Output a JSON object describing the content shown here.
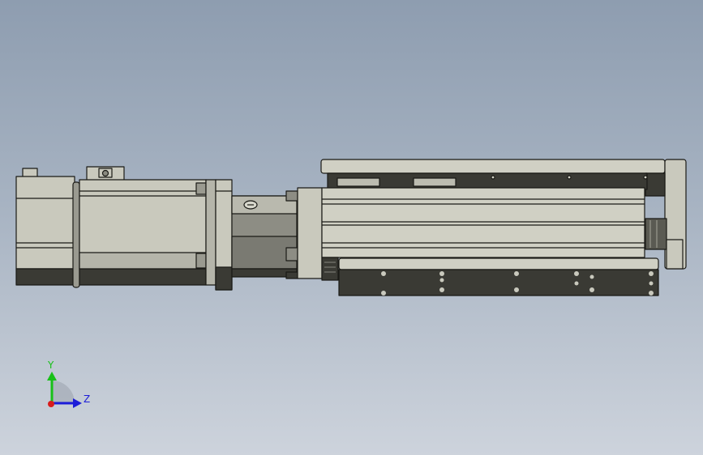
{
  "triad": {
    "y_label": "Y",
    "z_label": "Z",
    "y_color": "#18c018",
    "z_color": "#1c1cd8",
    "x_color": "#d81c1c"
  },
  "model": {
    "body_color": "#c9c9bd",
    "shadow_color": "#3a3a34",
    "edge_color": "#1a1a16"
  }
}
